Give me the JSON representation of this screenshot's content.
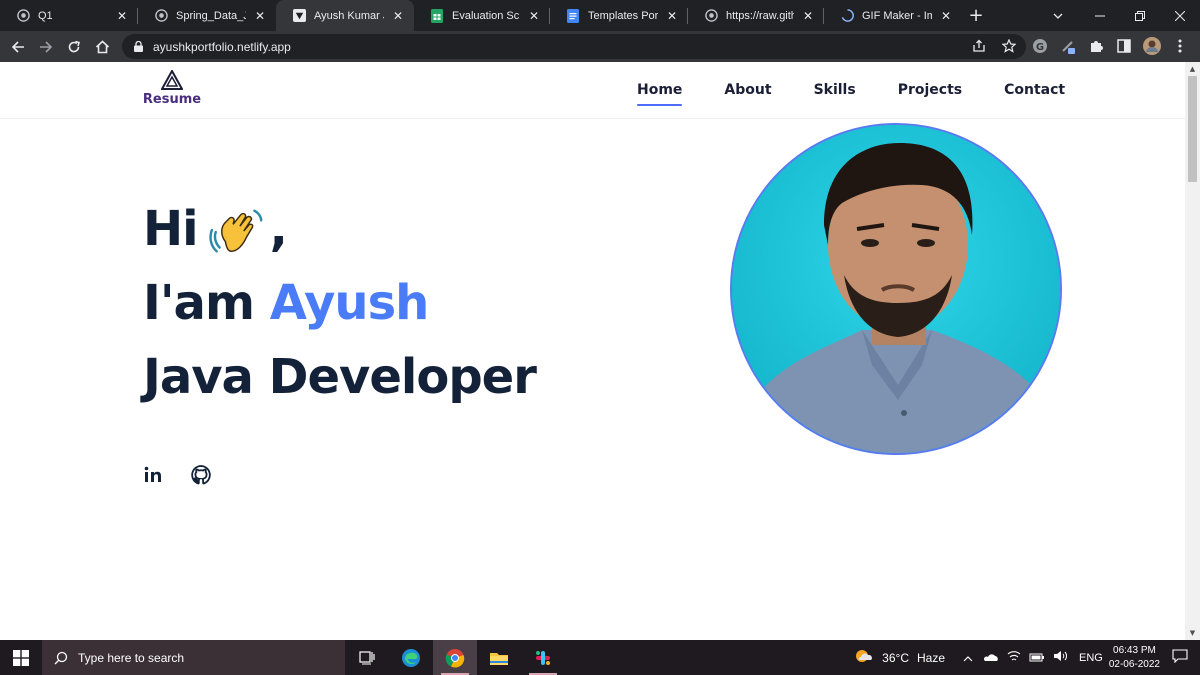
{
  "browser": {
    "tabs": [
      {
        "title": "Q1",
        "icon": "globe-icon"
      },
      {
        "title": "Spring_Data_JPA",
        "icon": "globe-icon"
      },
      {
        "title": "Ayush Kumar Jha",
        "icon": "vercel-icon",
        "active": true
      },
      {
        "title": "Evaluation Sched",
        "icon": "sheets-icon"
      },
      {
        "title": "Templates Portfo",
        "icon": "docs-icon"
      },
      {
        "title": "https://raw.githu",
        "icon": "globe-icon"
      },
      {
        "title": "GIF Maker - Imgf",
        "icon": "loading-icon"
      }
    ],
    "close_glyph": "✕",
    "new_tab_glyph": "+",
    "url": "ayushkportfolio.netlify.app"
  },
  "site": {
    "logo_label": "Resume",
    "nav": [
      "Home",
      "About",
      "Skills",
      "Projects",
      "Contact"
    ],
    "active_nav": "Home",
    "hero": {
      "greeting": "Hi",
      "greeting_suffix": ",",
      "intro_prefix": "I'am",
      "name": "Ayush",
      "role": "Java Developer"
    },
    "social": [
      "linkedin-icon",
      "github-icon"
    ],
    "accent": "#4a7cf7"
  },
  "taskbar": {
    "search_placeholder": "Type here to search",
    "weather_temp": "36°C",
    "weather_desc": "Haze",
    "lang": "ENG",
    "time": "06:43 PM",
    "date": "02-06-2022"
  }
}
